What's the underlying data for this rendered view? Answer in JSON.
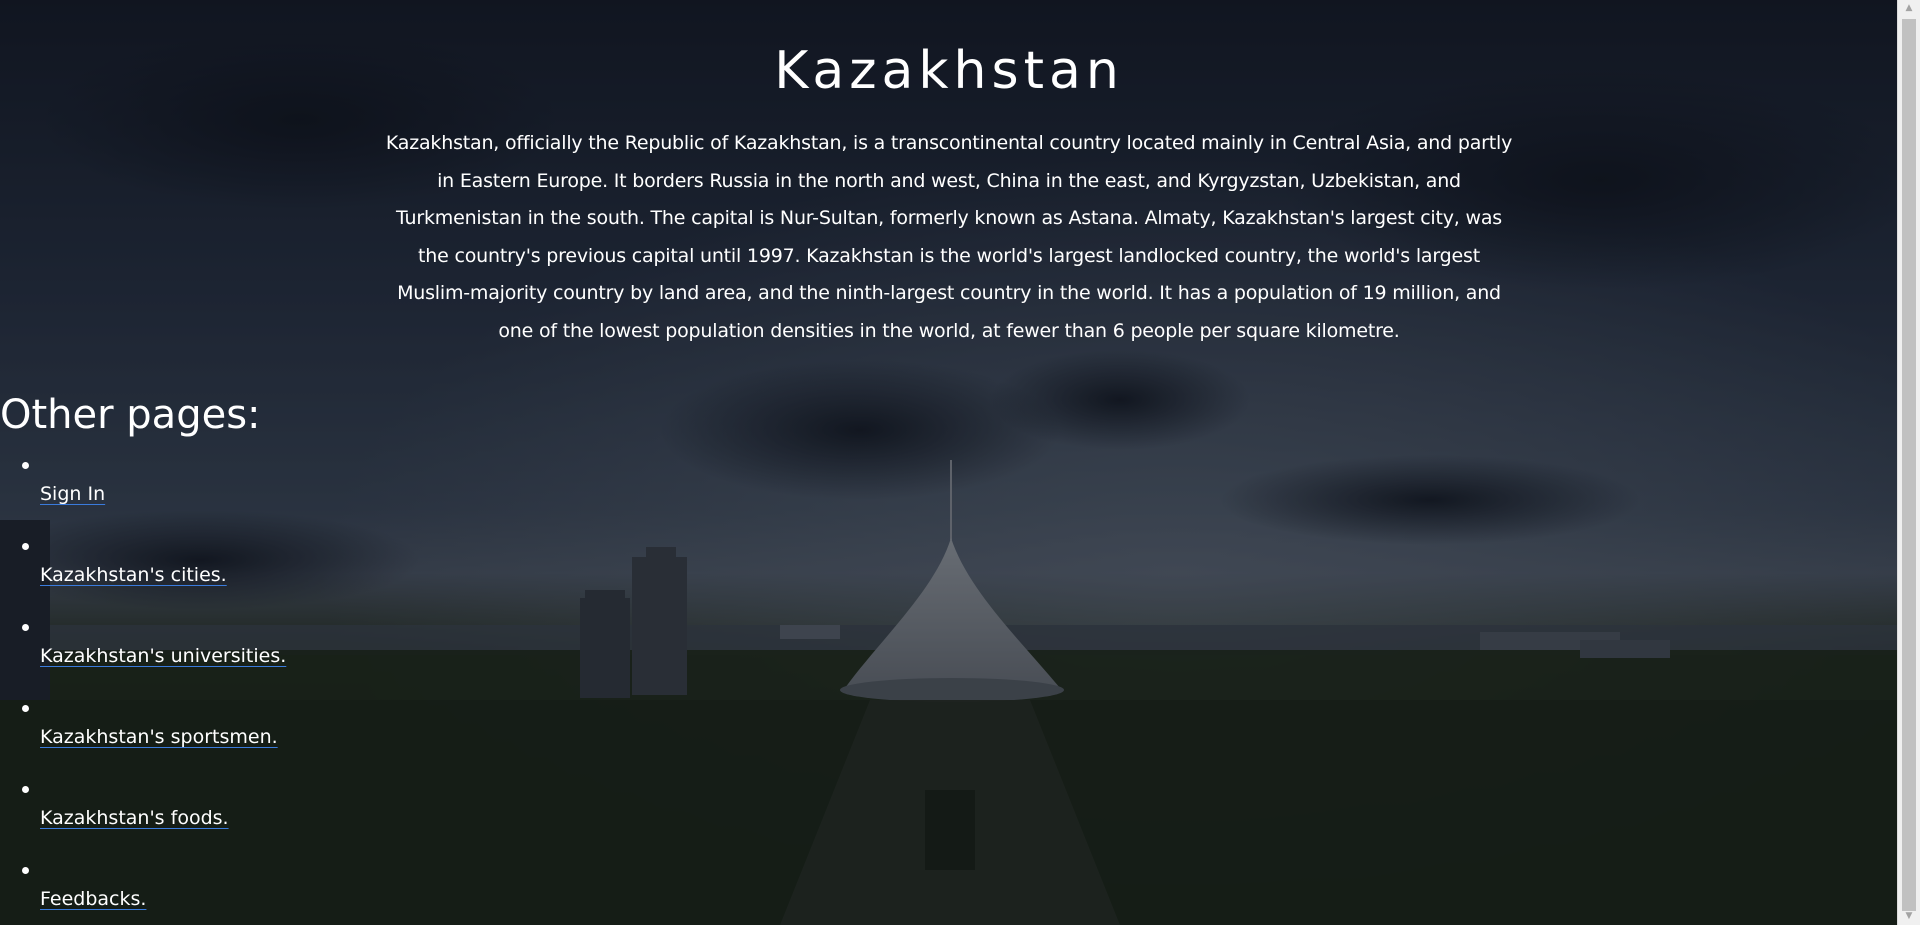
{
  "page": {
    "title": "Kazakhstan",
    "intro": "Kazakhstan, officially the Republic of Kazakhstan, is a transcontinental country located mainly in Central Asia, and partly in Eastern Europe. It borders Russia in the north and west, China in the east, and Kyrgyzstan, Uzbekistan, and Turkmenistan in the south. The capital is Nur-Sultan, formerly known as Astana. Almaty, Kazakhstan's largest city, was the country's previous capital until 1997. Kazakhstan is the world's largest landlocked country, the world's largest Muslim-majority country by land area, and the ninth-largest country in the world. It has a population of 19 million, and one of the lowest population densities in the world, at fewer than 6 people per square kilometre."
  },
  "nav": {
    "heading": "Other pages:",
    "links": [
      {
        "label": "Sign In"
      },
      {
        "label": "Kazakhstan's cities."
      },
      {
        "label": "Kazakhstan's universities."
      },
      {
        "label": "Kazakhstan's sportsmen."
      },
      {
        "label": "Kazakhstan's foods."
      },
      {
        "label": "Feedbacks."
      }
    ]
  },
  "background": {
    "description_icon": "city-skyline-background",
    "overlay_color": "#0b0f18"
  },
  "colors": {
    "text": "#ffffff",
    "link_underline": "#3a7bdc",
    "scrollbar_track": "#f0f0f0",
    "scrollbar_thumb": "#c1c1c1"
  }
}
